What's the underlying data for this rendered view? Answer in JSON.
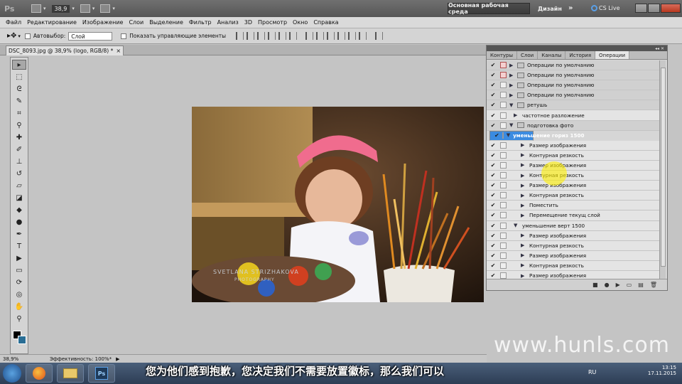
{
  "app": {
    "logo": "Ps",
    "zoom": "38,9",
    "workspace": "Основная рабочая среда",
    "design": "Дизайн",
    "more": "»",
    "cslive": "CS Live"
  },
  "menu": [
    "Файл",
    "Редактирование",
    "Изображение",
    "Слои",
    "Выделение",
    "Фильтр",
    "Анализ",
    "3D",
    "Просмотр",
    "Окно",
    "Справка"
  ],
  "options": {
    "autoselect_label": "Автовыбор:",
    "autoselect_value": "Слой",
    "show_controls": "Показать управляющие элементы"
  },
  "document": {
    "tab_title": "DSC_8093.jpg @ 38,9% (logo, RGB/8) *",
    "tab_close": "×"
  },
  "photo": {
    "signature": "SVETLANA STRIZHAKOVA",
    "signature_sub": "PHOTOGRAPHY"
  },
  "statusbar": {
    "zoom": "38,9%",
    "efficiency": "Эффективность: 100%*"
  },
  "panel": {
    "tabs": [
      "Контуры",
      "Слои",
      "Каналы",
      "История",
      "Операции"
    ],
    "active_tab": "Операции",
    "rows": [
      {
        "check": "✔",
        "dialog": true,
        "kind": "set",
        "collapsed": true,
        "label": "Операции по умолчанию"
      },
      {
        "check": "✔",
        "dialog": true,
        "kind": "set",
        "collapsed": true,
        "label": "Операции по умолчанию"
      },
      {
        "check": "✔",
        "dialog": false,
        "kind": "set",
        "collapsed": true,
        "label": "Операции по умолчанию"
      },
      {
        "check": "✔",
        "dialog": false,
        "kind": "set",
        "collapsed": true,
        "label": "Операции по умолчанию"
      },
      {
        "check": "✔",
        "dialog": false,
        "kind": "set",
        "collapsed": false,
        "label": "ретушь"
      },
      {
        "check": "✔",
        "dialog": false,
        "kind": "action",
        "collapsed": true,
        "label": "частотное разложение"
      },
      {
        "check": "✔",
        "dialog": false,
        "kind": "set",
        "collapsed": false,
        "label": "подготовка фото"
      },
      {
        "check": "✔",
        "dialog": false,
        "kind": "action",
        "collapsed": false,
        "selected": true,
        "label": "уменьшение гориз 1500"
      },
      {
        "check": "✔",
        "dialog": false,
        "kind": "step",
        "label": "Размер изображения"
      },
      {
        "check": "✔",
        "dialog": false,
        "kind": "step",
        "label": "Контурная резкость"
      },
      {
        "check": "✔",
        "dialog": false,
        "kind": "step",
        "label": "Размер изображения"
      },
      {
        "check": "✔",
        "dialog": false,
        "kind": "step",
        "label": "Контурная резкость"
      },
      {
        "check": "✔",
        "dialog": false,
        "kind": "step",
        "label": "Размер изображения"
      },
      {
        "check": "✔",
        "dialog": false,
        "kind": "step",
        "label": "Контурная резкость"
      },
      {
        "check": "✔",
        "dialog": false,
        "kind": "step",
        "label": "Поместить"
      },
      {
        "check": "✔",
        "dialog": false,
        "kind": "step",
        "label": "Перемещение текущ слой"
      },
      {
        "check": "✔",
        "dialog": false,
        "kind": "action",
        "collapsed": false,
        "label": "уменьшение верт 1500"
      },
      {
        "check": "✔",
        "dialog": false,
        "kind": "step",
        "label": "Размер изображения"
      },
      {
        "check": "✔",
        "dialog": false,
        "kind": "step",
        "label": "Контурная резкость"
      },
      {
        "check": "✔",
        "dialog": false,
        "kind": "step",
        "label": "Размер изображения"
      },
      {
        "check": "✔",
        "dialog": false,
        "kind": "step",
        "label": "Контурная резкость"
      },
      {
        "check": "✔",
        "dialog": false,
        "kind": "step",
        "label": "Размер изображения"
      }
    ],
    "footer_icons": [
      "■",
      "●",
      "▶",
      "▭",
      "▤",
      "🗑"
    ]
  },
  "overlay": {
    "watermark": "www.hunls.com",
    "subtitle": "您为他们感到抱歉，您决定我们不需要放置徽标，那么我们可以"
  },
  "taskbar": {
    "lang": "RU",
    "time": "13:15",
    "date": "17.11.2015"
  },
  "colors": {
    "foreground": "#000000",
    "background": "#2a6e95",
    "selection": "#3b8be0"
  }
}
